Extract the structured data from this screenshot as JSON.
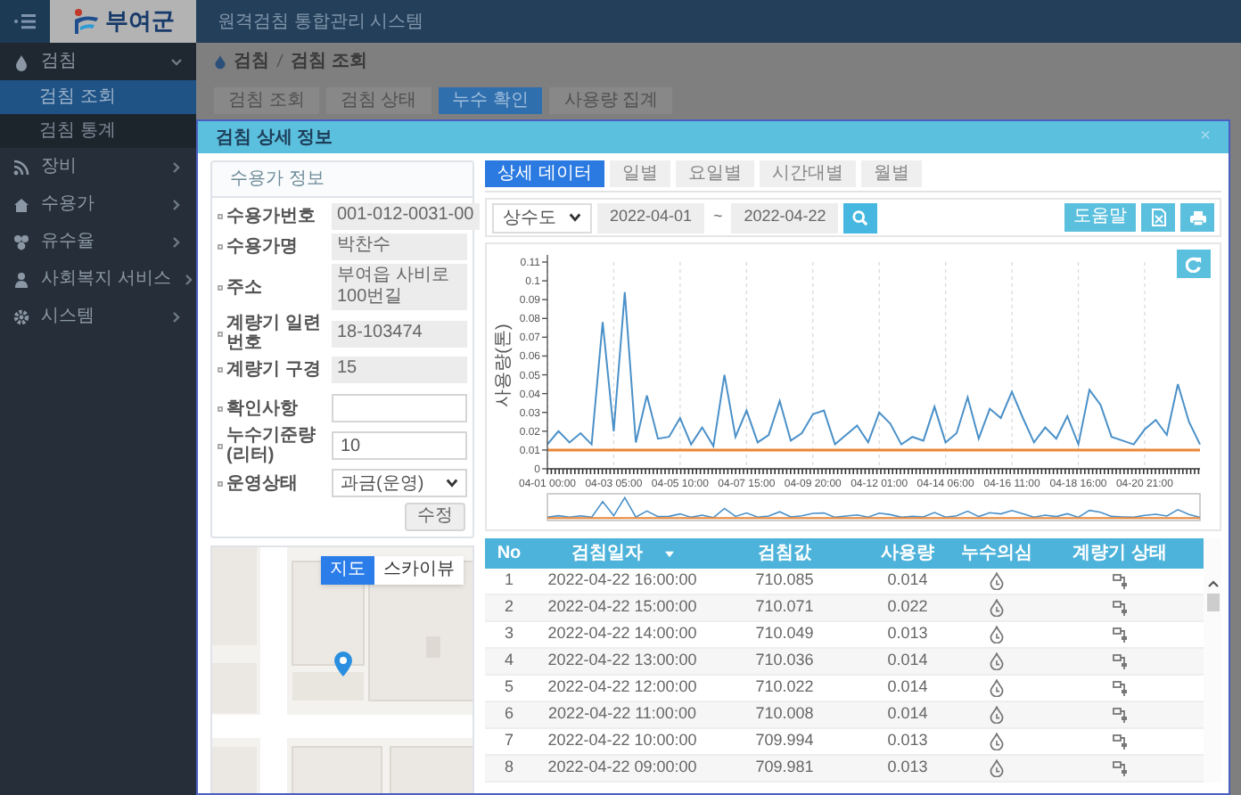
{
  "app": {
    "logo_text": "부여군",
    "title": "원격검침 통합관리 시스템"
  },
  "sidebar": {
    "items": [
      {
        "label": "검침",
        "expanded": true,
        "children": [
          {
            "label": "검침 조회",
            "selected": true
          },
          {
            "label": "검침 통계",
            "selected": false
          }
        ]
      },
      {
        "label": "장비",
        "expanded": false
      },
      {
        "label": "수용가",
        "expanded": false
      },
      {
        "label": "유수율",
        "expanded": false
      },
      {
        "label": "사회복지 서비스",
        "expanded": false
      },
      {
        "label": "시스템",
        "expanded": false
      }
    ]
  },
  "breadcrumb": [
    "검침",
    "검침 조회"
  ],
  "tabs": [
    {
      "label": "검침 조회",
      "selected": false
    },
    {
      "label": "검침 상태",
      "selected": false
    },
    {
      "label": "누수 확인",
      "selected": true
    },
    {
      "label": "사용량 집계",
      "selected": false
    }
  ],
  "modal": {
    "title": "검침 상세 정보",
    "close": "×"
  },
  "customer": {
    "title": "수용가 정보",
    "fields": [
      {
        "label": "수용가번호",
        "value": "001-012-0031-00",
        "kind": "readonly"
      },
      {
        "label": "수용가명",
        "value": "박찬수",
        "kind": "readonly"
      },
      {
        "label": "주소",
        "value": "부여읍 사비로100번길",
        "kind": "readonly"
      },
      {
        "label": "계량기 일련번호",
        "value": "18-103474",
        "kind": "readonly"
      },
      {
        "label": "계량기 구경",
        "value": "15",
        "kind": "readonly"
      },
      {
        "label": "확인사항",
        "kind": "input"
      },
      {
        "label": "누수기준량(리터)",
        "value": "10",
        "kind": "input"
      },
      {
        "label": "운영상태",
        "value": "과금(운영)",
        "kind": "select"
      }
    ],
    "save_button": "수정"
  },
  "map": {
    "kind": "picture",
    "modes": [
      {
        "label": "지도",
        "selected": true
      },
      {
        "label": "스카이뷰",
        "selected": false
      }
    ]
  },
  "view_tabs": [
    {
      "label": "상세 데이터",
      "selected": true
    },
    {
      "label": "일별",
      "selected": false
    },
    {
      "label": "요일별",
      "selected": false
    },
    {
      "label": "시간대별",
      "selected": false
    },
    {
      "label": "월별",
      "selected": false
    }
  ],
  "filter": {
    "source": "상수도",
    "from": "2022-04-01",
    "separator": "~",
    "to": "2022-04-22",
    "help_button": "도움말"
  },
  "chart_data": {
    "type": "line",
    "grid": true,
    "ylabel": "사용량(톤)",
    "ylim": [
      0,
      0.11
    ],
    "categories": [
      "04-01 00:00",
      null,
      null,
      null,
      null,
      null,
      "04-03 05:00",
      null,
      null,
      null,
      null,
      null,
      "04-05 10:00",
      null,
      null,
      null,
      null,
      null,
      "04-07 15:00",
      null,
      null,
      null,
      null,
      null,
      "04-09 20:00",
      null,
      null,
      null,
      null,
      null,
      "04-12 01:00",
      null,
      null,
      null,
      null,
      null,
      "04-14 06:00",
      null,
      null,
      null,
      null,
      null,
      "04-16 11:00",
      null,
      null,
      null,
      null,
      null,
      "04-18 16:00",
      null,
      null,
      null,
      null,
      null,
      "04-20 21:00",
      null,
      null,
      null,
      null,
      null
    ],
    "yticks": [
      0,
      0.01,
      0.02,
      0.03,
      0.04,
      0.05,
      0.06,
      0.07,
      0.08,
      0.09,
      0.1,
      0.11
    ],
    "series": [
      {
        "color": "#4a90c8",
        "values": [
          0.013,
          0.02,
          0.014,
          0.019,
          0.013,
          0.078,
          0.02,
          0.094,
          0.014,
          0.039,
          0.016,
          0.017,
          0.027,
          0.013,
          0.022,
          0.012,
          0.05,
          0.017,
          0.031,
          0.014,
          0.018,
          0.036,
          0.015,
          0.019,
          0.029,
          0.031,
          0.013,
          0.018,
          0.023,
          0.014,
          0.03,
          0.024,
          0.013,
          0.017,
          0.015,
          0.033,
          0.014,
          0.019,
          0.038,
          0.016,
          0.032,
          0.027,
          0.041,
          0.027,
          0.014,
          0.022,
          0.016,
          0.028,
          0.013,
          0.042,
          0.034,
          0.017,
          0.015,
          0.013,
          0.021,
          0.026,
          0.018,
          0.045,
          0.025,
          0.013
        ]
      },
      {
        "color": "#e8873a",
        "values": [
          0.01,
          0.01,
          0.01,
          0.01,
          0.01,
          0.01,
          0.01,
          0.01,
          0.01,
          0.01,
          0.01,
          0.01,
          0.01,
          0.01,
          0.01,
          0.01,
          0.01,
          0.01,
          0.01,
          0.01,
          0.01,
          0.01,
          0.01,
          0.01,
          0.01,
          0.01,
          0.01,
          0.01,
          0.01,
          0.01,
          0.01,
          0.01,
          0.01,
          0.01,
          0.01,
          0.01,
          0.01,
          0.01,
          0.01,
          0.01,
          0.01,
          0.01,
          0.01,
          0.01,
          0.01,
          0.01,
          0.01,
          0.01,
          0.01,
          0.01,
          0.01,
          0.01,
          0.01,
          0.01,
          0.01,
          0.01,
          0.01,
          0.01,
          0.01,
          0.01
        ]
      }
    ]
  },
  "table": {
    "columns": [
      "No",
      "검침일자",
      "검침값",
      "사용량",
      "누수의심",
      "계량기 상태"
    ],
    "rows": [
      {
        "no": "1",
        "time": "2022-04-22 16:00:00",
        "reading": "710.085",
        "usage": "0.014"
      },
      {
        "no": "2",
        "time": "2022-04-22 15:00:00",
        "reading": "710.071",
        "usage": "0.022"
      },
      {
        "no": "3",
        "time": "2022-04-22 14:00:00",
        "reading": "710.049",
        "usage": "0.013"
      },
      {
        "no": "4",
        "time": "2022-04-22 13:00:00",
        "reading": "710.036",
        "usage": "0.014"
      },
      {
        "no": "5",
        "time": "2022-04-22 12:00:00",
        "reading": "710.022",
        "usage": "0.014"
      },
      {
        "no": "6",
        "time": "2022-04-22 11:00:00",
        "reading": "710.008",
        "usage": "0.014"
      },
      {
        "no": "7",
        "time": "2022-04-22 10:00:00",
        "reading": "709.994",
        "usage": "0.013"
      },
      {
        "no": "8",
        "time": "2022-04-22 09:00:00",
        "reading": "709.981",
        "usage": "0.013"
      }
    ]
  }
}
